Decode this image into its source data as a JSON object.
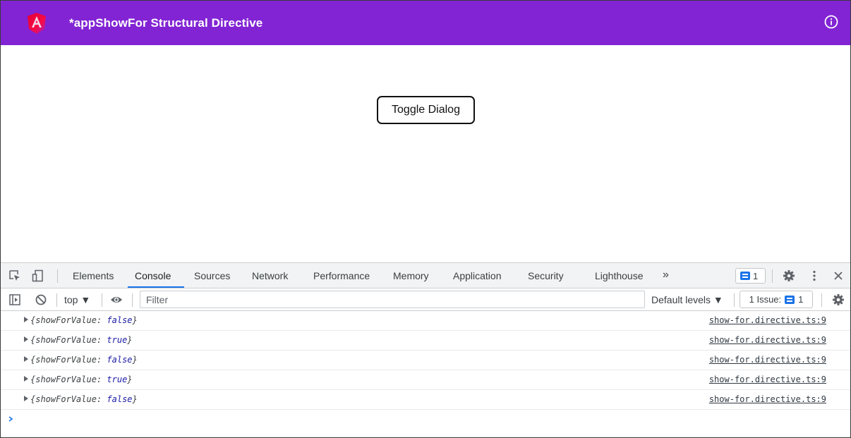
{
  "app": {
    "title": "*appShowFor Structural Directive",
    "header_color": "#8224d4",
    "toggle_label": "Toggle Dialog"
  },
  "devtools": {
    "tabs": [
      "Elements",
      "Console",
      "Sources",
      "Network",
      "Performance",
      "Memory",
      "Application",
      "Security",
      "Lighthouse"
    ],
    "active_tab": "Console",
    "more_tabs": "»",
    "messages_count": "1",
    "context": "top ▼",
    "filter_placeholder": "Filter",
    "default_levels": "Default levels ▼",
    "issues_label": "1 Issue:",
    "issues_count": "1"
  },
  "console": {
    "key": "showForValue",
    "lines": [
      {
        "value": "false",
        "source": "show-for.directive.ts:9"
      },
      {
        "value": "true",
        "source": "show-for.directive.ts:9"
      },
      {
        "value": "false",
        "source": "show-for.directive.ts:9"
      },
      {
        "value": "true",
        "source": "show-for.directive.ts:9"
      },
      {
        "value": "false",
        "source": "show-for.directive.ts:9"
      }
    ]
  },
  "icons": [
    "angular-logo-icon",
    "info-icon",
    "inspect-element-icon",
    "device-toolbar-icon",
    "messages-icon",
    "settings-icon",
    "more-vert-icon",
    "close-icon",
    "sidebar-icon",
    "clear-console-icon",
    "eye-icon",
    "prompt-chevron-icon"
  ]
}
